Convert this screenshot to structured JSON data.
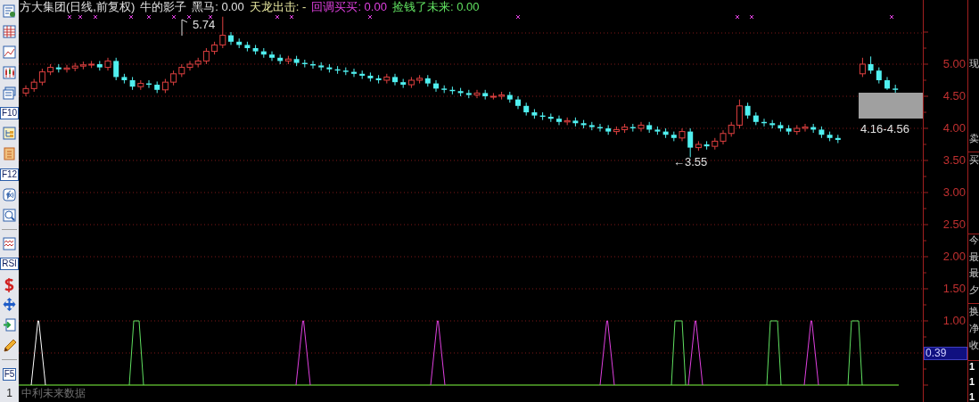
{
  "toolbar": [
    {
      "kind": "icon"
    },
    {
      "kind": "icon"
    },
    {
      "kind": "icon"
    },
    {
      "kind": "icon"
    },
    {
      "kind": "icon"
    },
    {
      "kind": "label",
      "text": "F10"
    },
    {
      "kind": "icon"
    },
    {
      "kind": "icon"
    },
    {
      "kind": "label",
      "text": "F12"
    },
    {
      "kind": "icon"
    },
    {
      "kind": "icon"
    },
    {
      "kind": "separator"
    },
    {
      "kind": "icon"
    },
    {
      "kind": "label",
      "text": "RSI"
    },
    {
      "kind": "icon"
    },
    {
      "kind": "icon"
    },
    {
      "kind": "icon"
    },
    {
      "kind": "icon"
    },
    {
      "kind": "separator"
    },
    {
      "kind": "label",
      "text": "F5"
    },
    {
      "kind": "plain",
      "text": "1"
    }
  ],
  "header": [
    {
      "text": "方大集团(日线,前复权)",
      "color": "#e0e0e0"
    },
    {
      "text": "牛的影子",
      "color": "#e0e0e0"
    },
    {
      "text": "黑马: 0.00",
      "color": "#e0e0e0"
    },
    {
      "text": "天龙出击: -",
      "color": "#e8e8a0"
    },
    {
      "text": "回调买买: 0.00",
      "color": "#e040e0"
    },
    {
      "text": "捡钱了未来: 0.00",
      "color": "#60e060"
    }
  ],
  "price_chart": {
    "chart_data": {
      "type": "candlestick",
      "ohlc": [
        [
          4.55,
          4.67,
          4.5,
          4.62
        ],
        [
          4.62,
          4.77,
          4.57,
          4.72
        ],
        [
          4.72,
          4.93,
          4.67,
          4.88
        ],
        [
          4.88,
          5.0,
          4.83,
          4.95
        ],
        [
          4.95,
          5.0,
          4.87,
          4.92
        ],
        [
          4.92,
          4.99,
          4.87,
          4.94
        ],
        [
          4.94,
          5.02,
          4.89,
          4.97
        ],
        [
          4.97,
          5.04,
          4.92,
          4.99
        ],
        [
          4.99,
          5.05,
          4.94,
          5.0
        ],
        [
          5.0,
          5.05,
          4.9,
          4.95
        ],
        [
          4.95,
          5.1,
          4.9,
          5.05
        ],
        [
          5.05,
          5.1,
          4.75,
          4.8
        ],
        [
          4.8,
          4.85,
          4.7,
          4.75
        ],
        [
          4.75,
          4.8,
          4.6,
          4.65
        ],
        [
          4.65,
          4.75,
          4.6,
          4.7
        ],
        [
          4.7,
          4.75,
          4.63,
          4.68
        ],
        [
          4.68,
          4.73,
          4.55,
          4.6
        ],
        [
          4.6,
          4.77,
          4.55,
          4.72
        ],
        [
          4.72,
          4.9,
          4.67,
          4.85
        ],
        [
          4.85,
          5.0,
          4.8,
          4.95
        ],
        [
          4.95,
          5.05,
          4.9,
          5.0
        ],
        [
          5.0,
          5.1,
          4.95,
          5.05
        ],
        [
          5.05,
          5.25,
          5.0,
          5.2
        ],
        [
          5.2,
          5.35,
          5.15,
          5.3
        ],
        [
          5.3,
          5.74,
          5.25,
          5.45
        ],
        [
          5.45,
          5.5,
          5.3,
          5.35
        ],
        [
          5.35,
          5.4,
          5.25,
          5.3
        ],
        [
          5.3,
          5.35,
          5.2,
          5.25
        ],
        [
          5.25,
          5.3,
          5.15,
          5.2
        ],
        [
          5.2,
          5.25,
          5.1,
          5.15
        ],
        [
          5.15,
          5.2,
          5.05,
          5.1
        ],
        [
          5.1,
          5.15,
          5.0,
          5.05
        ],
        [
          5.05,
          5.13,
          5.0,
          5.08
        ],
        [
          5.08,
          5.13,
          4.97,
          5.02
        ],
        [
          5.02,
          5.07,
          4.95,
          5.0
        ],
        [
          5.0,
          5.05,
          4.93,
          4.98
        ],
        [
          4.98,
          5.03,
          4.9,
          4.95
        ],
        [
          4.95,
          5.0,
          4.87,
          4.92
        ],
        [
          4.92,
          4.97,
          4.85,
          4.9
        ],
        [
          4.9,
          4.95,
          4.83,
          4.88
        ],
        [
          4.88,
          4.93,
          4.8,
          4.85
        ],
        [
          4.85,
          4.9,
          4.77,
          4.82
        ],
        [
          4.82,
          4.87,
          4.73,
          4.78
        ],
        [
          4.78,
          4.83,
          4.7,
          4.75
        ],
        [
          4.75,
          4.85,
          4.7,
          4.8
        ],
        [
          4.8,
          4.85,
          4.67,
          4.72
        ],
        [
          4.72,
          4.77,
          4.63,
          4.68
        ],
        [
          4.68,
          4.8,
          4.63,
          4.75
        ],
        [
          4.75,
          4.83,
          4.7,
          4.78
        ],
        [
          4.78,
          4.83,
          4.65,
          4.7
        ],
        [
          4.7,
          4.75,
          4.57,
          4.62
        ],
        [
          4.62,
          4.67,
          4.55,
          4.6
        ],
        [
          4.6,
          4.65,
          4.53,
          4.58
        ],
        [
          4.58,
          4.63,
          4.5,
          4.55
        ],
        [
          4.55,
          4.6,
          4.47,
          4.52
        ],
        [
          4.52,
          4.6,
          4.47,
          4.55
        ],
        [
          4.55,
          4.6,
          4.45,
          4.5
        ],
        [
          4.5,
          4.55,
          4.45,
          4.5
        ],
        [
          4.5,
          4.57,
          4.45,
          4.52
        ],
        [
          4.52,
          4.57,
          4.4,
          4.45
        ],
        [
          4.45,
          4.5,
          4.3,
          4.35
        ],
        [
          4.35,
          4.4,
          4.2,
          4.25
        ],
        [
          4.25,
          4.3,
          4.15,
          4.2
        ],
        [
          4.2,
          4.25,
          4.13,
          4.18
        ],
        [
          4.18,
          4.23,
          4.1,
          4.15
        ],
        [
          4.15,
          4.2,
          4.05,
          4.1
        ],
        [
          4.1,
          4.17,
          4.05,
          4.12
        ],
        [
          4.12,
          4.17,
          4.03,
          4.08
        ],
        [
          4.08,
          4.13,
          4.0,
          4.05
        ],
        [
          4.05,
          4.1,
          3.97,
          4.02
        ],
        [
          4.02,
          4.07,
          3.95,
          4.0
        ],
        [
          4.0,
          4.05,
          3.9,
          3.95
        ],
        [
          3.95,
          4.03,
          3.9,
          3.98
        ],
        [
          3.98,
          4.07,
          3.93,
          4.02
        ],
        [
          4.02,
          4.07,
          3.95,
          4.0
        ],
        [
          4.0,
          4.1,
          3.95,
          4.05
        ],
        [
          4.05,
          4.1,
          3.93,
          3.98
        ],
        [
          3.98,
          4.03,
          3.9,
          3.95
        ],
        [
          3.95,
          4.0,
          3.85,
          3.9
        ],
        [
          3.9,
          3.95,
          3.8,
          3.85
        ],
        [
          3.85,
          4.0,
          3.8,
          3.95
        ],
        [
          3.95,
          4.0,
          3.55,
          3.7
        ],
        [
          3.7,
          3.8,
          3.65,
          3.75
        ],
        [
          3.75,
          3.8,
          3.67,
          3.72
        ],
        [
          3.72,
          3.85,
          3.67,
          3.8
        ],
        [
          3.8,
          3.97,
          3.75,
          3.92
        ],
        [
          3.92,
          4.1,
          3.87,
          4.05
        ],
        [
          4.05,
          4.45,
          4.0,
          4.35
        ],
        [
          4.35,
          4.4,
          4.15,
          4.2
        ],
        [
          4.2,
          4.25,
          4.05,
          4.1
        ],
        [
          4.1,
          4.15,
          4.03,
          4.08
        ],
        [
          4.08,
          4.13,
          4.0,
          4.05
        ],
        [
          4.05,
          4.1,
          3.95,
          4.0
        ],
        [
          4.0,
          4.05,
          3.9,
          3.95
        ],
        [
          3.95,
          4.05,
          3.9,
          4.0
        ],
        [
          4.0,
          4.07,
          3.95,
          4.02
        ],
        [
          4.02,
          4.07,
          3.93,
          3.98
        ],
        [
          3.98,
          4.03,
          3.85,
          3.9
        ],
        [
          3.9,
          3.95,
          3.8,
          3.85
        ],
        [
          3.85,
          3.9,
          3.77,
          3.82
        ],
        null,
        null,
        [
          4.85,
          5.1,
          4.8,
          5.0
        ],
        [
          5.0,
          5.12,
          4.85,
          4.9
        ],
        [
          4.9,
          4.95,
          4.7,
          4.75
        ],
        [
          4.75,
          4.8,
          4.6,
          4.62
        ],
        [
          4.62,
          4.68,
          4.55,
          4.6
        ]
      ],
      "ylim": [
        -0.2639,
        6
      ],
      "grid": true,
      "yticks": [
        {
          "value": 5,
          "label": "5.00"
        },
        {
          "value": 4.5,
          "label": "4.50"
        },
        {
          "value": 4,
          "label": "4.00"
        },
        {
          "value": 3.5,
          "label": "3.50"
        },
        {
          "value": 3,
          "label": "3.00"
        },
        {
          "value": 2.5,
          "label": "2.50"
        },
        {
          "value": 2,
          "label": "2.00"
        },
        {
          "value": 1.5,
          "label": "1.50"
        },
        {
          "value": 1,
          "label": "1.00"
        }
      ]
    }
  },
  "annotations": {
    "high": "5.74",
    "low": "←3.55",
    "range": "4.16-4.56"
  },
  "indicator_label": "中利未来数据",
  "indicator_value": "0.39",
  "side_panel": [
    "现",
    "卖",
    "买",
    "今",
    "最",
    "最",
    "夕",
    "换",
    "净",
    "收",
    "1",
    "1",
    "1"
  ]
}
